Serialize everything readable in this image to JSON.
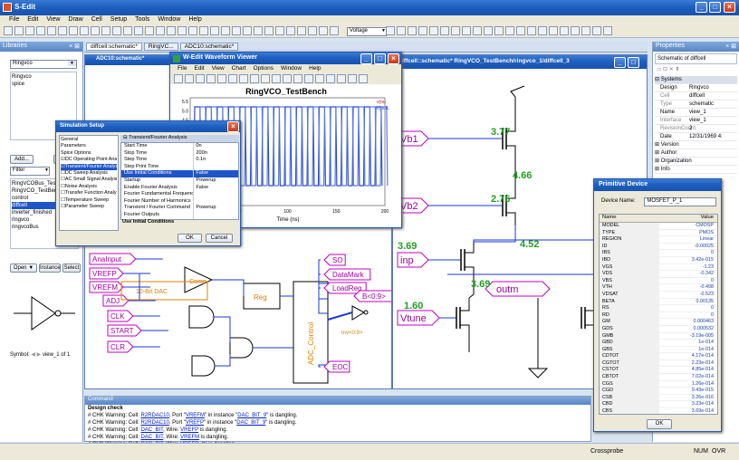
{
  "app": {
    "title": "S-Edit"
  },
  "menu": [
    "File",
    "Edit",
    "View",
    "Draw",
    "Cell",
    "Setup",
    "Tools",
    "Window",
    "Help"
  ],
  "toolbar": {
    "voltage": "Voltage"
  },
  "libraries": {
    "header": "Libraries",
    "selected": "Ringvco",
    "libs": [
      "Ringvco",
      "spice"
    ],
    "add_label": "Add...",
    "remove_label": "Re",
    "filter_label": "Filter",
    "cells": [
      "RingVCOBus_TestBench",
      "RingVCO_TestBench",
      "control",
      "diffcell",
      "inverter_finished",
      "ringvco",
      "ringvcoBus"
    ],
    "open_label": "Open",
    "instance_label": "Instance",
    "select_label": "Select",
    "symbol_label": "Symbol:",
    "symbol_value": "view_1 of 1"
  },
  "doc_tabs": [
    "diffcell:schematic*",
    "RingVC...",
    "ADC10:schematic*"
  ],
  "adc_window": {
    "title": "ADC10:schematic*"
  },
  "diff_window": {
    "title": "diffcell::schematic* RingVCO_TestBench/ringvco_1/diffcell_3"
  },
  "waveform": {
    "title": "W-Edit Waveform Viewer",
    "menu": [
      "File",
      "Edit",
      "View",
      "Chart",
      "Options",
      "Window",
      "Help"
    ],
    "chart_title": "RingVCO_TestBench",
    "legend": [
      "v(ou",
      "v(outL"
    ],
    "yticks": [
      "5.5",
      "5.0",
      "4.5",
      "4.0",
      "3.5",
      "3.0",
      "2.5",
      "2.0",
      "1.5",
      "1.0",
      "0.5",
      "0.0"
    ],
    "xticks": [
      "50",
      "100",
      "150",
      "200"
    ],
    "xlabel": "Time (ns)"
  },
  "sim_setup": {
    "title": "Simulation Setup",
    "analyses": [
      "General",
      "Parameters",
      "Spice Options",
      "DC Operating Point Analysis",
      "Transient/Fourier Analysis",
      "DC Sweep Analysis",
      "AC Small Signal Analysis",
      "Noise Analysis",
      "Transfer Function Analysis",
      "Temperature Sweep",
      "Parameter Sweep"
    ],
    "checked": [
      true,
      true,
      false,
      false,
      false,
      false,
      false,
      false
    ],
    "params_header": "Transient/Fourier Analysis",
    "params": [
      [
        "Start Time",
        "0n"
      ],
      [
        "Stop Time",
        "200n"
      ],
      [
        "Step Time",
        "0.1n"
      ],
      [
        "Step Print Time",
        ""
      ],
      [
        "Use Initial Conditions",
        "False"
      ],
      [
        "Startup",
        "Powerup"
      ],
      [
        "Enable Fourier Analysis",
        "False"
      ],
      [
        "Fourier Fundamental Frequency",
        ""
      ],
      [
        "Fourier Number of Harmonics",
        ""
      ],
      [
        "Transient / Fourier Command",
        "Powerup"
      ],
      [
        "Fourier Outputs",
        ""
      ]
    ],
    "description": "Use Initial Conditions",
    "ok": "OK",
    "cancel": "Cancel"
  },
  "adc_schematic": {
    "ports_in": [
      "AnaInput",
      "VREFP",
      "VREFM",
      "ADJ",
      "CLK",
      "START",
      "CLR"
    ],
    "ports_out": [
      "SO",
      "DataMark",
      "LoadReg",
      "EOC"
    ],
    "bus_port": "B<0:9>",
    "comp": "Comp",
    "dac": "10-Bit DAC",
    "reg": "Reg",
    "control": "ADC_Control",
    "inv": "Inv<0:9>"
  },
  "diff_schematic": {
    "ports": [
      "Vb1",
      "Vb2",
      "inp",
      "Vtune",
      "outm"
    ],
    "voltages": [
      "3.77",
      "4.66",
      "2.76",
      "4.52",
      "3.69",
      "1.60",
      "3.69",
      "3.69"
    ]
  },
  "properties": {
    "header": "Properties",
    "schematic_of": "Schematic of diffcell",
    "systems": "Systems",
    "rows": [
      [
        "Design",
        "Ringvco"
      ],
      [
        "Cell",
        "diffcell"
      ],
      [
        "Type",
        "schematic"
      ],
      [
        "Name",
        "view_1"
      ],
      [
        "Interface",
        "view_1"
      ],
      [
        "RevisionCount",
        "2"
      ],
      [
        "Date",
        "12/31/1969 4:"
      ]
    ],
    "groups": [
      "Version",
      "Author",
      "Organization",
      "Info"
    ]
  },
  "primitive": {
    "title": "Primitive Device",
    "device_label": "Device Name:",
    "device_name": "MOSFET_P_1",
    "col_name": "Name",
    "col_value": "Value",
    "rows": [
      [
        "MODEL",
        "CMOSP"
      ],
      [
        "TYPE",
        "PMOS"
      ],
      [
        "REGION",
        "Linear"
      ],
      [
        "ID",
        "-0.00025"
      ],
      [
        "IBS",
        "0"
      ],
      [
        "IBD",
        "3.42e-015"
      ],
      [
        "VGS",
        "-1.23"
      ],
      [
        "VDS",
        "-0.342"
      ],
      [
        "VBS",
        "0"
      ],
      [
        "VTH",
        "-0.498"
      ],
      [
        "VDSAT",
        "-0.523"
      ],
      [
        "BETA",
        "0.00135"
      ],
      [
        "RS",
        "0"
      ],
      [
        "RD",
        "0"
      ],
      [
        "GM",
        "0.000463"
      ],
      [
        "GDS",
        "0.000532"
      ],
      [
        "GMB",
        "-3.19e-005"
      ],
      [
        "GBD",
        "1e-014"
      ],
      [
        "GBS",
        "1e-014"
      ],
      [
        "CDTOT",
        "4.17e-014"
      ],
      [
        "CGTOT",
        "2.23e-014"
      ],
      [
        "CSTOT",
        "4.85e-014"
      ],
      [
        "CBTOT",
        "7.02e-014"
      ],
      [
        "CGS",
        "1.26e-014"
      ],
      [
        "CGD",
        "9.43e-015"
      ],
      [
        "CSB",
        "3.26e-016"
      ],
      [
        "CBD",
        "3.23e-014"
      ],
      [
        "CBS",
        "3.69e-014"
      ]
    ],
    "ok": "OK"
  },
  "command": {
    "header": "Command",
    "lines": [
      [
        "Design check"
      ],
      [
        "# CHK Warning: Cell: ",
        "R2RDAC10",
        ", Port \"",
        "VREFM",
        "\" in instance \"",
        "DAC_BIT_9",
        "\" is dangling."
      ],
      [
        "# CHK Warning: Cell: ",
        "R2RDAC10",
        ", Port \"",
        "VREFP",
        "\" in instance \"",
        "DAC_BIT_9",
        "\" is dangling."
      ],
      [
        "# CHK Warning: Cell: ",
        "DAC_BIT",
        ", Wire: ",
        "VREFP",
        " is dangling."
      ],
      [
        "# CHK Warning: Cell: ",
        "DAC_BIT",
        ", Wire: ",
        "VREFM",
        " is dangling."
      ],
      [
        "# CHK Warning: Cell: ",
        "DAC_BIT",
        ", Wire: ",
        "VREFP_IN",
        " is dangling."
      ]
    ]
  },
  "status": {
    "crossprobe": "Crossprobe",
    "num": "NUM",
    "ovr": "OVR"
  }
}
